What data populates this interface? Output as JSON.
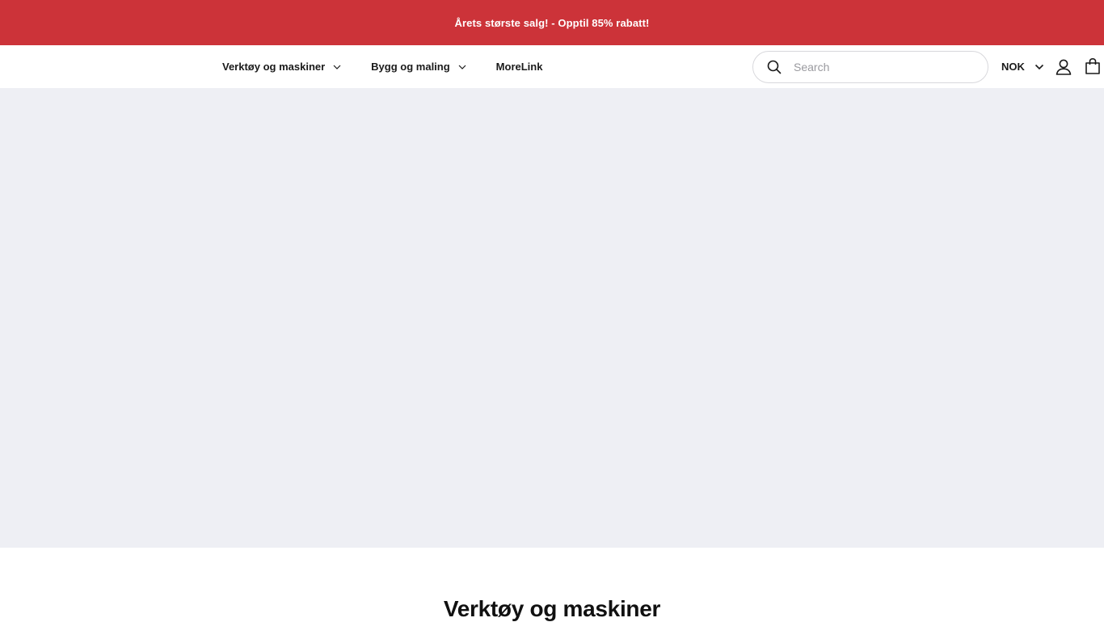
{
  "announcement": {
    "text": "Årets største salg! - Opptil 85% rabatt!",
    "background": "#cc3339"
  },
  "nav": {
    "items": [
      {
        "label": "Verktøy og maskiner",
        "has_dropdown": true
      },
      {
        "label": "Bygg og maling",
        "has_dropdown": true
      },
      {
        "label": "MoreLink",
        "has_dropdown": false
      }
    ]
  },
  "search": {
    "placeholder": "Search",
    "value": "",
    "icon": "search-icon"
  },
  "currency": {
    "value": "NOK",
    "icon": "chevron-down-icon"
  },
  "header_icons": {
    "account": "user-icon",
    "cart": "shopping-bag-icon"
  },
  "hero": {
    "background": "#eeeff4"
  },
  "section": {
    "title": "Verktøy og maskiner"
  }
}
